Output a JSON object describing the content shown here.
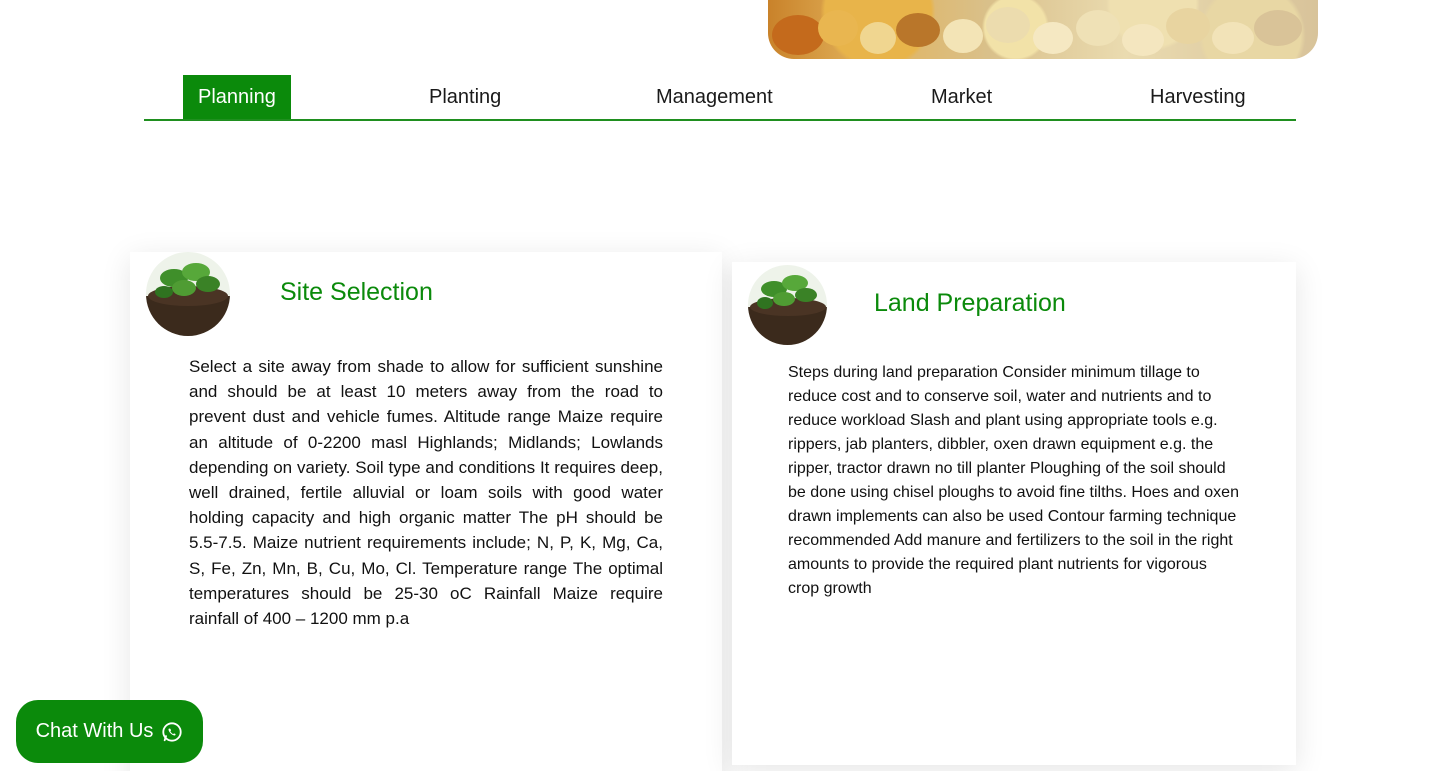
{
  "tabs": [
    {
      "label": "Planning",
      "active": true
    },
    {
      "label": "Planting",
      "active": false
    },
    {
      "label": "Management",
      "active": false
    },
    {
      "label": "Market",
      "active": false
    },
    {
      "label": "Harvesting",
      "active": false
    }
  ],
  "cards": [
    {
      "title": "Site Selection",
      "icon": "plant-soil-image",
      "body": "Select a site away from shade to allow for sufficient sunshine and should be at least 10 meters away from the road to prevent dust and vehicle fumes. Altitude range Maize require an altitude of 0-2200 masl Highlands; Midlands; Lowlands depending on variety. Soil type and conditions It requires deep, well drained, fertile alluvial or loam soils with good water holding capacity and high organic matter The pH should be 5.5-7.5. Maize nutrient requirements include; N, P, K, Mg, Ca, S, Fe, Zn, Mn, B, Cu, Mo, Cl. Temperature range The optimal temperatures should be 25-30 oC Rainfall Maize require rainfall of 400 – 1200 mm p.a"
    },
    {
      "title": "Land Preparation",
      "icon": "plant-soil-image",
      "body": "Steps during land preparation Consider minimum tillage to reduce cost and to conserve soil, water and nutrients and to reduce workload Slash and plant using appropriate tools e.g. rippers, jab planters, dibbler, oxen drawn equipment e.g. the ripper, tractor drawn no till planter Ploughing of the soil should be done using chisel ploughs to avoid fine tilths. Hoes and oxen drawn implements can also be used Contour farming technique recommended Add manure and fertilizers to the soil in the right amounts to provide the required plant nutrients for vigorous crop growth"
    }
  ],
  "chat": {
    "label": "Chat With Us",
    "icon": "whatsapp-icon"
  },
  "colors": {
    "accent": "#0b8a0b",
    "tab_underline": "#1f8f1f"
  }
}
